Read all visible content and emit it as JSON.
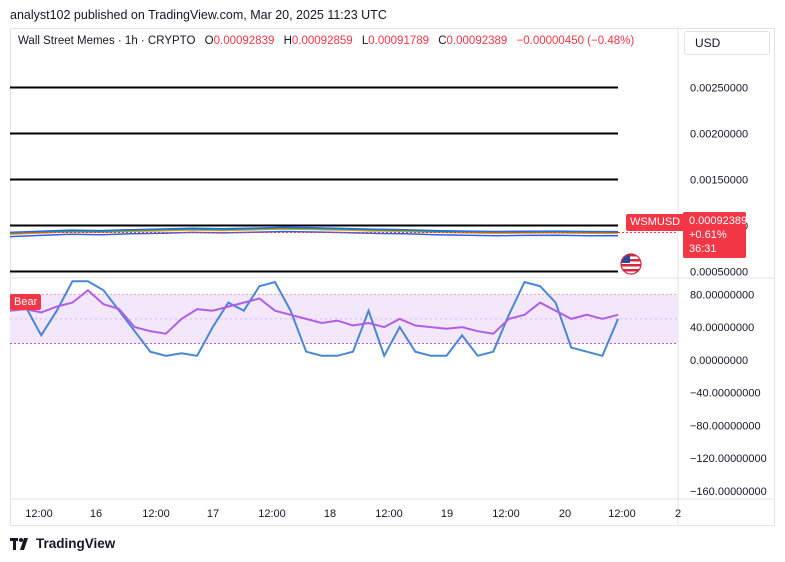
{
  "publisher": "analyst102 published on TradingView.com, Mar 20, 2025 11:23 UTC",
  "ohlc": {
    "symbol_name": "Wall Street Memes · 1h · CRYPTO",
    "open_label": "O",
    "open": "0.00092839",
    "high_label": "H",
    "high": "0.00092859",
    "low_label": "L",
    "low": "0.00091789",
    "close_label": "C",
    "close": "0.00092389",
    "change": "−0.00000450 (−0.48%)"
  },
  "currency": "USD",
  "price_tag": {
    "price": "0.00092389",
    "change": "+0.61%",
    "countdown": "36:31"
  },
  "symbol_tag": "WSMUSD",
  "indicator_tag": "Bear",
  "branding": "TradingView",
  "colors": {
    "down": "#f23645",
    "stoch_k": "#4a86d6",
    "stoch_d": "#b05ee8",
    "band_fill": "#f3e8fb"
  },
  "icons": {
    "flag": "us-flag-icon",
    "logo": "tradingview-logo-icon"
  },
  "chart_data": [
    {
      "type": "line",
      "title": "Wall Street Memes · 1h · CRYPTO",
      "y_ticks": [
        "0.00250000",
        "0.00200000",
        "0.00150000",
        "0.00100000",
        "0.00050000"
      ],
      "x_ticks": [
        "12:00",
        "16",
        "12:00",
        "17",
        "12:00",
        "18",
        "12:00",
        "19",
        "12:00",
        "20",
        "12:00",
        "2"
      ],
      "horizontal_levels": [
        0.0025,
        0.002,
        0.0015,
        0.001,
        0.0005
      ],
      "ylim": [
        0.00043,
        0.00282
      ],
      "x_domain": [
        0,
        110
      ],
      "series": [
        {
          "values": [
            0.000915,
            0.000928,
            0.00094,
            0.000935,
            0.000945,
            0.000952,
            0.00096,
            0.000955,
            0.000962,
            0.00097,
            0.000965,
            0.000958,
            0.00095,
            0.000945,
            0.000935,
            0.00093,
            0.000925,
            0.000928,
            0.00093,
            0.000925,
            0.00092389
          ]
        }
      ]
    },
    {
      "type": "line",
      "y_ticks": [
        "80.00000000",
        "40.00000000",
        "0.00000000",
        "−40.00000000",
        "−80.00000000",
        "−120.00000000",
        "−160.00000000"
      ],
      "ylim": [
        -170,
        100
      ],
      "band": [
        20,
        80
      ],
      "x_domain": [
        0,
        110
      ],
      "series": [
        {
          "values": [
            70,
            65,
            30,
            60,
            96,
            96,
            85,
            60,
            35,
            10,
            5,
            8,
            5,
            40,
            70,
            60,
            90,
            95,
            60,
            10,
            5,
            5,
            10,
            60,
            5,
            40,
            10,
            5,
            5,
            30,
            5,
            10,
            55,
            95,
            90,
            70,
            15,
            10,
            5,
            50
          ]
        },
        {
          "values": [
            60,
            62,
            58,
            65,
            70,
            85,
            68,
            62,
            40,
            35,
            32,
            50,
            62,
            60,
            65,
            70,
            75,
            60,
            55,
            50,
            45,
            48,
            42,
            45,
            40,
            50,
            42,
            40,
            38,
            40,
            35,
            32,
            50,
            55,
            70,
            60,
            50,
            55,
            50,
            55
          ]
        }
      ]
    }
  ]
}
